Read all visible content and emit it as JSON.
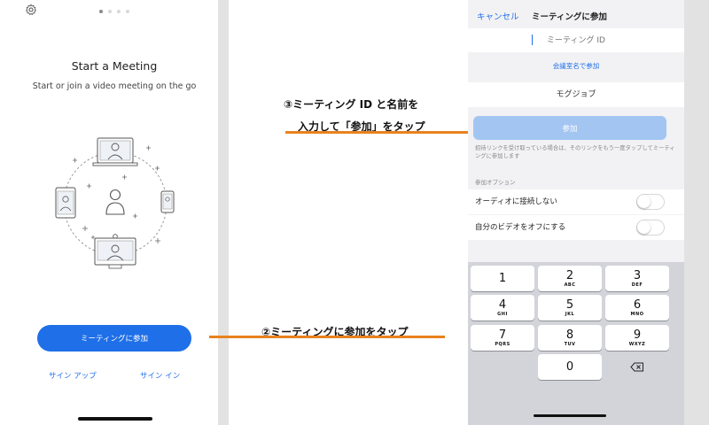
{
  "left_screen": {
    "title": "Start a Meeting",
    "subtitle": "Start or join a video meeting on the go",
    "join_button": "ミーティングに参加",
    "sign_up": "サイン アップ",
    "sign_in": "サイン イン",
    "icons": {
      "settings": "gear-icon",
      "illustration": "meeting-illustration"
    },
    "page_dots": {
      "total": 4,
      "active": 1
    }
  },
  "annotations": {
    "step2": "②ミーティングに参加をタップ",
    "step3_line1": "③ミーティング ID と名前を",
    "step3_line2": "入力して「参加」をタップ",
    "line_color": "#e8821e"
  },
  "right_screen": {
    "cancel": "キャンセル",
    "title": "ミーティングに参加",
    "meeting_id_placeholder": "ミーティング ID",
    "room_name_link": "会議室名で参加",
    "name_value": "モグジョブ",
    "join_button": "参加",
    "note": "招待リンクを受け取っている場合は、そのリンクをもう一度タップしてミーティングに参加します",
    "options_header": "参加オプション",
    "options": [
      {
        "label": "オーディオに接続しない",
        "on": false
      },
      {
        "label": "自分のビデオをオフにする",
        "on": false
      }
    ],
    "keypad": [
      {
        "digit": "1",
        "letters": ""
      },
      {
        "digit": "2",
        "letters": "ABC"
      },
      {
        "digit": "3",
        "letters": "DEF"
      },
      {
        "digit": "4",
        "letters": "GHI"
      },
      {
        "digit": "5",
        "letters": "JKL"
      },
      {
        "digit": "6",
        "letters": "MNO"
      },
      {
        "digit": "7",
        "letters": "PQRS"
      },
      {
        "digit": "8",
        "letters": "TUV"
      },
      {
        "digit": "9",
        "letters": "WXYZ"
      },
      {
        "digit": "0",
        "letters": ""
      }
    ]
  },
  "colors": {
    "accent": "#1f6fe8",
    "join_disabled": "#a3c5f2"
  }
}
